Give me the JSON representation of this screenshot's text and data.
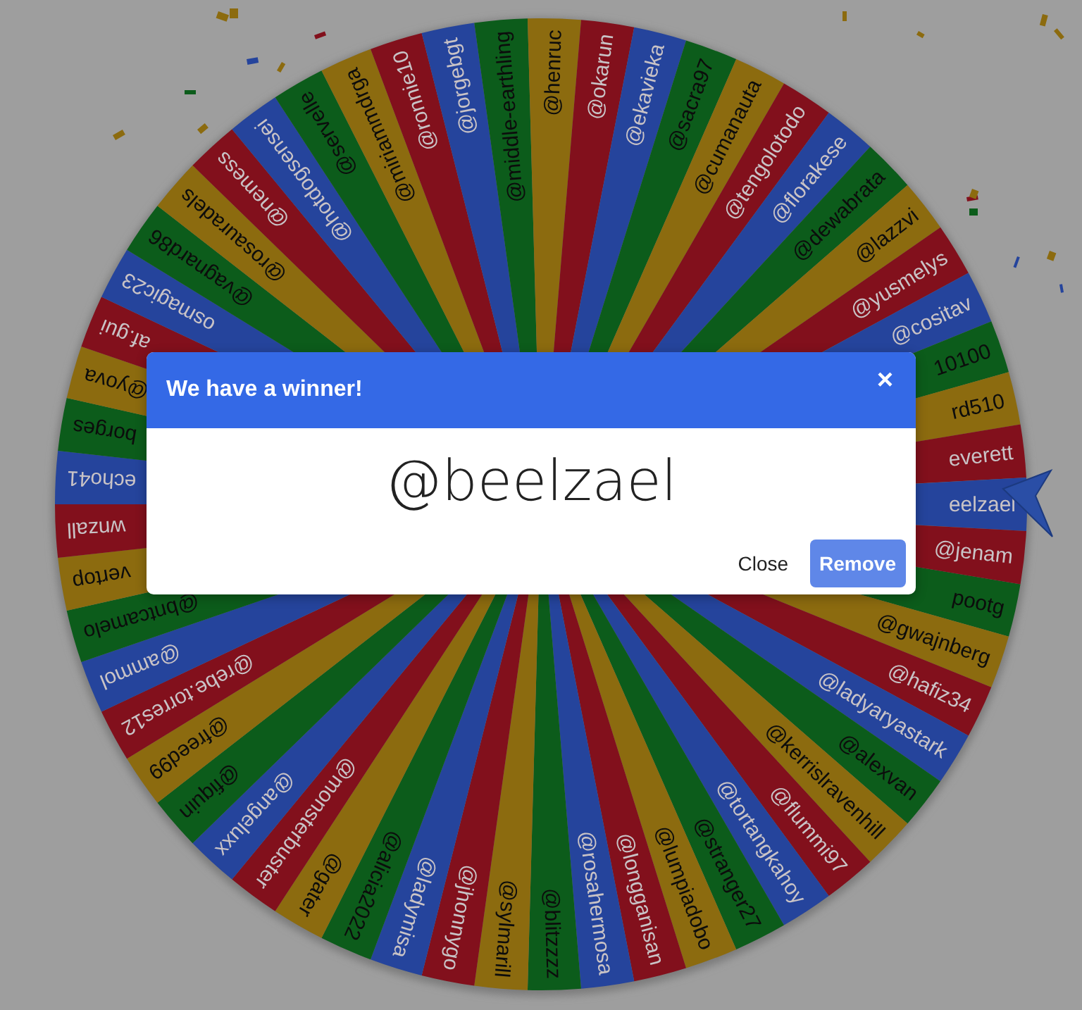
{
  "wheel": {
    "segments": [
      {
        "label": "pootg"
      },
      {
        "label": "@gwajnberg"
      },
      {
        "label": "@hafiz34"
      },
      {
        "label": "@ladyaryastark"
      },
      {
        "label": "@alexvan"
      },
      {
        "label": "@kerrislravenhill"
      },
      {
        "label": "@flummi97"
      },
      {
        "label": "@tortangkahoy"
      },
      {
        "label": "@stranger27"
      },
      {
        "label": "@lumpiadobo"
      },
      {
        "label": "@longganisan"
      },
      {
        "label": "@rosahermosa"
      },
      {
        "label": "@blitzzzz"
      },
      {
        "label": "@sylmarill"
      },
      {
        "label": "@jhonnygo"
      },
      {
        "label": "@ladymisa"
      },
      {
        "label": "@alicia2022"
      },
      {
        "label": "@gater"
      },
      {
        "label": "@monsterbuster"
      },
      {
        "label": "@angeluxx"
      },
      {
        "label": "@fiquin"
      },
      {
        "label": "@freed99"
      },
      {
        "label": "@rebe.torres12"
      },
      {
        "label": "@ammol"
      },
      {
        "label": "@bntcamelo"
      },
      {
        "label": "vertop"
      },
      {
        "label": "wnzall"
      },
      {
        "label": "echo41"
      },
      {
        "label": "borges"
      },
      {
        "label": "@yova"
      },
      {
        "label": "af.gui"
      },
      {
        "label": "osmagic23"
      },
      {
        "label": "@vagnard86"
      },
      {
        "label": "@rosauradels"
      },
      {
        "label": "@nemess"
      },
      {
        "label": "@hotdogsensei"
      },
      {
        "label": "@servelle"
      },
      {
        "label": "@miriammdrga"
      },
      {
        "label": "@ronnie10"
      },
      {
        "label": "@jorgebgt"
      },
      {
        "label": "@middle-earthling"
      },
      {
        "label": "@henruc"
      },
      {
        "label": "@okarun"
      },
      {
        "label": "@ekavieka"
      },
      {
        "label": "@sacra97"
      },
      {
        "label": "@cumanauta"
      },
      {
        "label": "@tengolotodo"
      },
      {
        "label": "@florakese"
      },
      {
        "label": "@dewabrata"
      },
      {
        "label": "@lazzvi"
      },
      {
        "label": "@yusmelys"
      },
      {
        "label": "@cositav"
      },
      {
        "label": "10100"
      },
      {
        "label": "rd510"
      },
      {
        "label": "everett"
      },
      {
        "label": "eelzael"
      },
      {
        "label": "@jenam"
      }
    ]
  },
  "dialog": {
    "title": "We have a winner!",
    "close_icon": "×",
    "winner": "@beelzael",
    "buttons": [
      {
        "label": "Close",
        "kind": "text"
      },
      {
        "label": "Remove",
        "kind": "primary"
      }
    ]
  }
}
